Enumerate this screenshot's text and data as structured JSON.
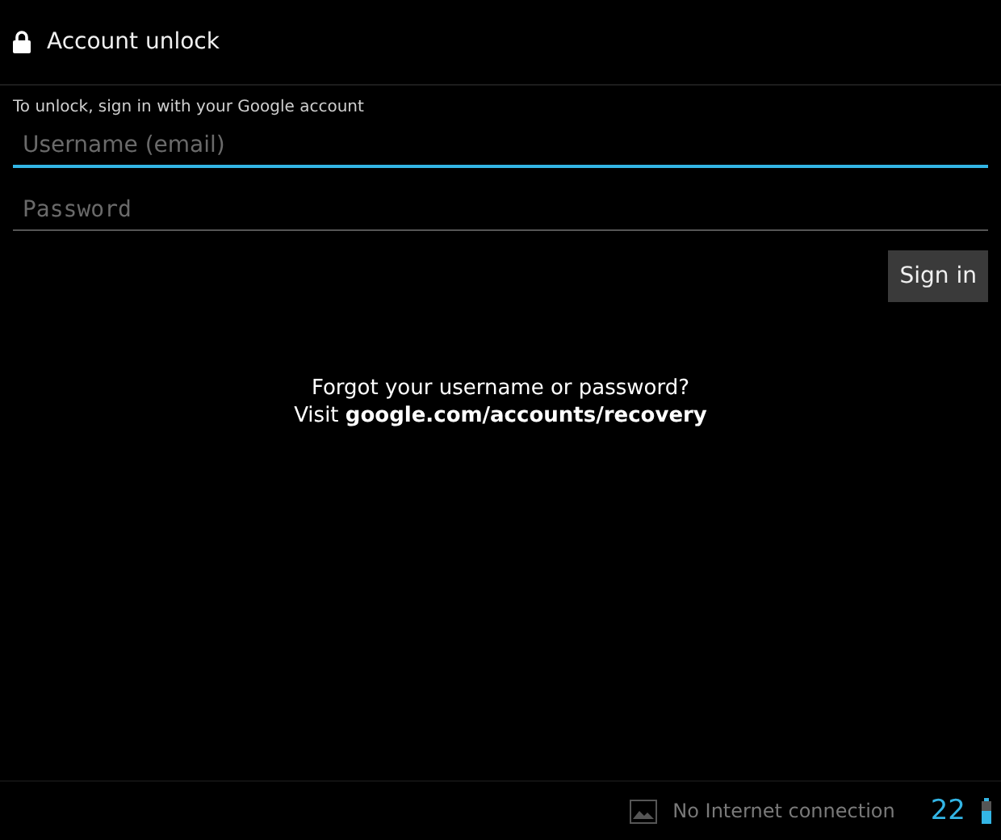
{
  "header": {
    "title": "Account unlock"
  },
  "instruction": "To unlock, sign in with your Google account",
  "fields": [
    {
      "placeholder": "Username (email)",
      "focused": true,
      "kind": "text"
    },
    {
      "placeholder": "Password",
      "focused": false,
      "kind": "password"
    }
  ],
  "sign_in_button": "Sign in",
  "help": {
    "question": "Forgot your username or password?",
    "prefix": "Visit",
    "link": "google.com/accounts/recovery"
  },
  "status_bar": {
    "notification": "No Internet connection",
    "time": "22"
  }
}
